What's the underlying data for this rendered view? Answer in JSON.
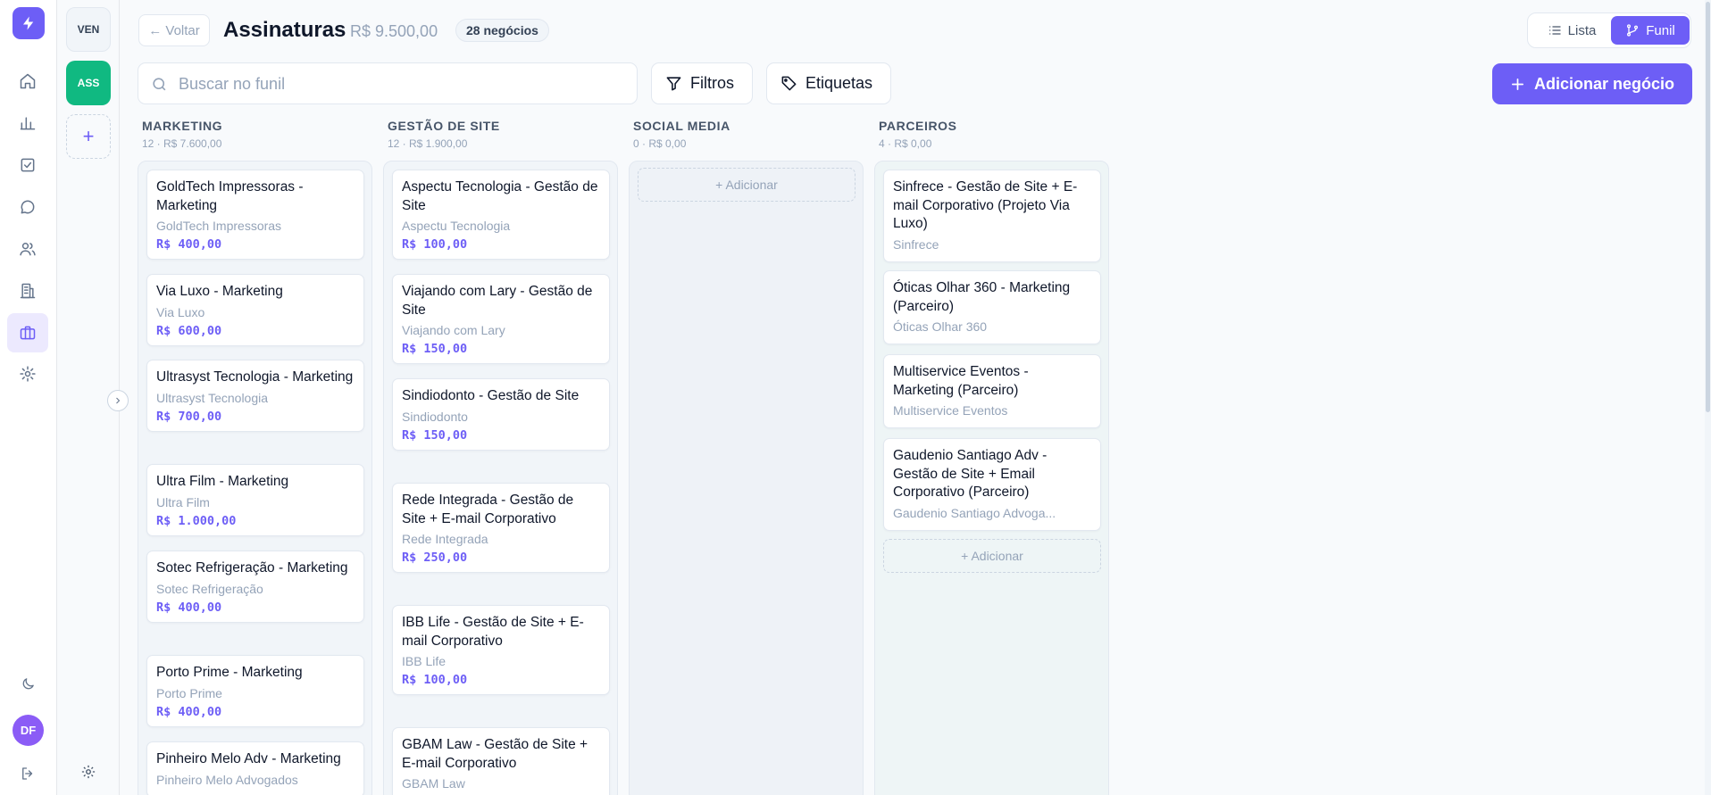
{
  "rail": {
    "items": [
      {
        "icon": "home-icon"
      },
      {
        "icon": "bar-chart-icon"
      },
      {
        "icon": "tasks-icon"
      },
      {
        "icon": "chat-icon"
      },
      {
        "icon": "contacts-icon"
      },
      {
        "icon": "building-icon"
      },
      {
        "icon": "briefcase-icon",
        "active": true
      },
      {
        "icon": "settings-icon"
      }
    ],
    "avatar_initials": "DF"
  },
  "pipelines": {
    "items": [
      "VEN",
      "ASS"
    ],
    "active": "ASS",
    "add_label": "+"
  },
  "header": {
    "back_label": "← Voltar",
    "title": "Assinaturas",
    "total": "R$ 9.500,00",
    "deal_count": "28 negócios",
    "view_list_label": "Lista",
    "view_funnel_label": "Funil",
    "active_view": "Funil"
  },
  "toolbar": {
    "search_placeholder": "Buscar no funil",
    "search_value": "",
    "filters_label": "Filtros",
    "tags_label": "Etiquetas",
    "add_deal_label": "Adicionar negócio"
  },
  "add_label": "+ Adicionar",
  "colors": {
    "accent": "#6d5ef6",
    "pipeline_active": "#10b981",
    "avatar": "#8b5cf6"
  },
  "stages": [
    {
      "name": "MARKETING",
      "meta": "12 · R$ 7.600,00",
      "cards": [
        {
          "title": "GoldTech Impressoras - Marketing",
          "company": "GoldTech Impressoras",
          "value": "R$ 400,00"
        },
        {
          "title": "Via Luxo - Marketing",
          "company": "Via Luxo",
          "value": "R$ 600,00"
        },
        {
          "title": "Ultrasyst Tecnologia - Marketing",
          "company": "Ultrasyst Tecnologia",
          "value": "R$ 700,00"
        },
        {
          "title": "Ultra Film - Marketing",
          "company": "Ultra Film",
          "value": "R$ 1.000,00"
        },
        {
          "title": "Sotec Refrigeração - Marketing",
          "company": "Sotec Refrigeração",
          "value": "R$ 400,00"
        },
        {
          "title": "Porto Prime - Marketing",
          "company": "Porto Prime",
          "value": "R$ 400,00"
        },
        {
          "title": "Pinheiro Melo Adv - Marketing",
          "company": "Pinheiro Melo Advogados",
          "value": ""
        }
      ]
    },
    {
      "name": "GESTÃO DE SITE",
      "meta": "12 · R$ 1.900,00",
      "cards": [
        {
          "title": "Aspectu Tecnologia - Gestão de Site",
          "company": "Aspectu Tecnologia",
          "value": "R$ 100,00"
        },
        {
          "title": "Viajando com Lary - Gestão de Site",
          "company": "Viajando com Lary",
          "value": "R$ 150,00"
        },
        {
          "title": "Sindiodonto - Gestão de Site",
          "company": "Sindiodonto",
          "value": "R$ 150,00"
        },
        {
          "title": "Rede Integrada - Gestão de Site + E-mail Corporativo",
          "company": "Rede Integrada",
          "value": "R$ 250,00"
        },
        {
          "title": "IBB Life - Gestão de Site + E-mail Corporativo",
          "company": "IBB Life",
          "value": "R$ 100,00"
        },
        {
          "title": "GBAM Law - Gestão de Site + E-mail Corporativo",
          "company": "GBAM Law",
          "value": "R$ 100,00"
        }
      ]
    },
    {
      "name": "SOCIAL MEDIA",
      "meta": "0 · R$ 0,00",
      "cards": []
    },
    {
      "name": "PARCEIROS",
      "meta": "4 · R$ 0,00",
      "cards": [
        {
          "title": "Sinfrece - Gestão de Site + E-mail Corporativo (Projeto Via Luxo)",
          "company": "Sinfrece",
          "value": ""
        },
        {
          "title": "Óticas Olhar 360 - Marketing (Parceiro)",
          "company": "Óticas Olhar 360",
          "value": ""
        },
        {
          "title": "Multiservice Eventos - Marketing (Parceiro)",
          "company": "Multiservice Eventos",
          "value": ""
        },
        {
          "title": "Gaudenio Santiago Adv - Gestão de Site + Email Corporativo (Parceiro)",
          "company": "Gaudenio Santiago Advoga...",
          "value": ""
        }
      ]
    }
  ]
}
